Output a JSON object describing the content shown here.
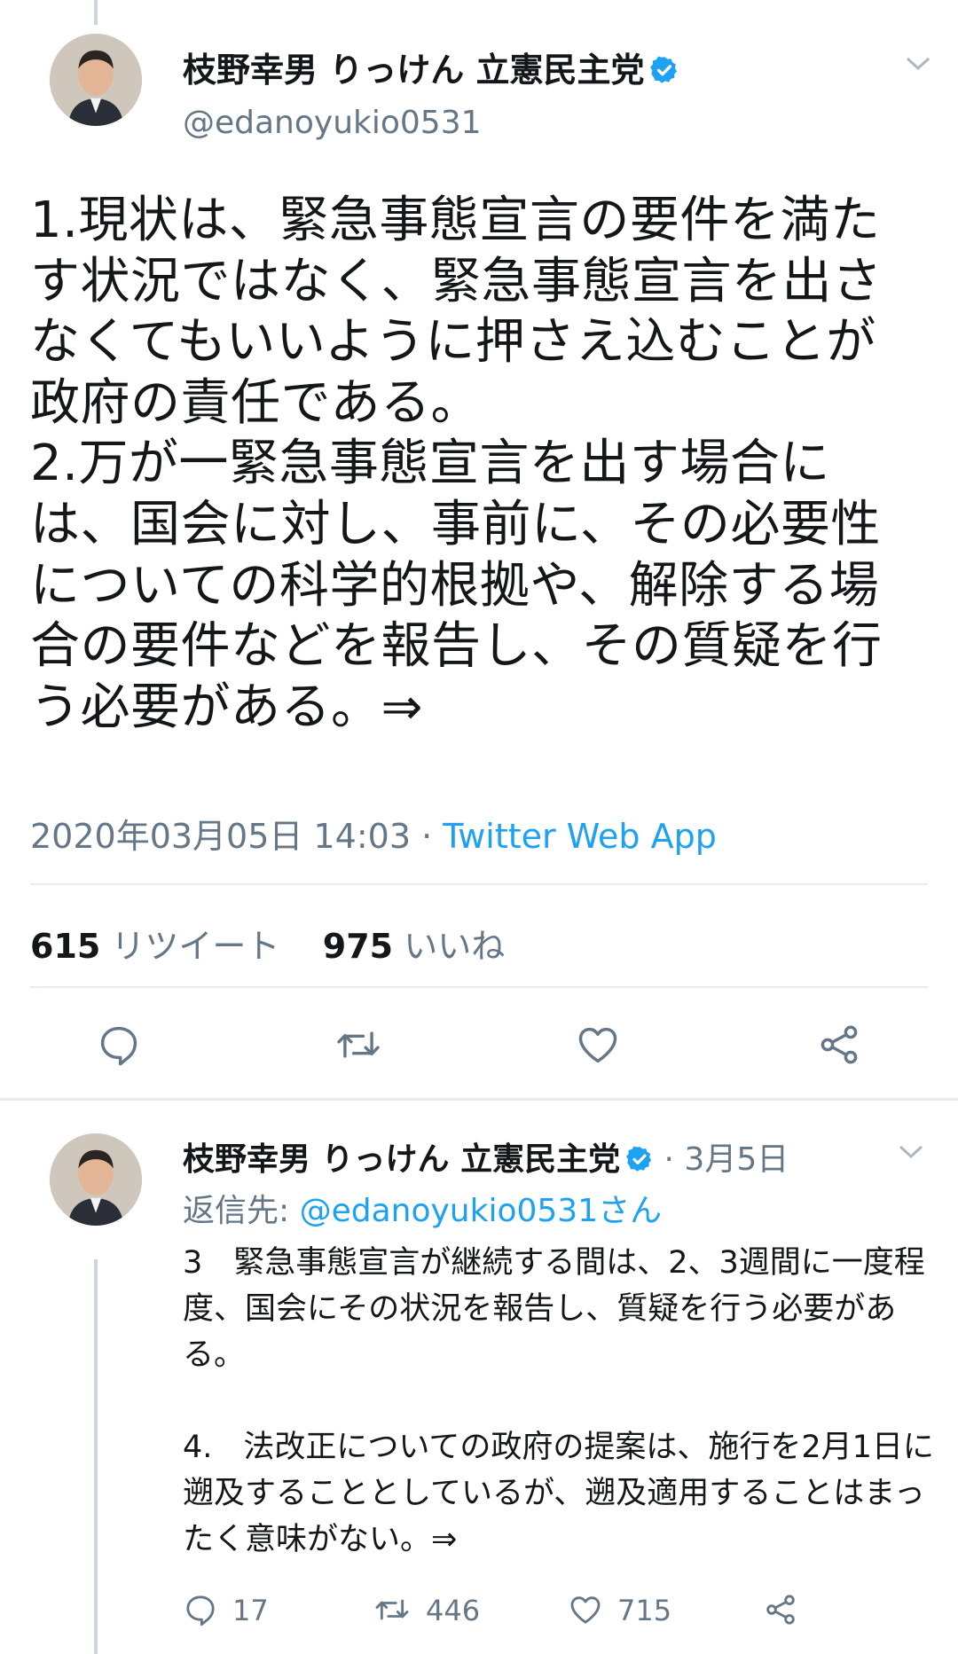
{
  "main_tweet": {
    "author_name": "枝野幸男 りっけん 立憲民主党",
    "handle": "@edanoyukio0531",
    "text": "1.現状は、緊急事態宣言の要件を満たす状況ではなく、緊急事態宣言を出さなくてもいいように押さえ込むことが政府の責任である。\n2.万が一緊急事態宣言を出す場合には、国会に対し、事前に、その必要性についての科学的根拠や、解除する場合の要件などを報告し、その質疑を行う必要がある。⇒",
    "timestamp": "2020年03月05日 14:03",
    "separator": " · ",
    "source": "Twitter Web App",
    "retweet_count": "615",
    "retweet_label": "リツイート",
    "like_count": "975",
    "like_label": "いいね"
  },
  "reply_tweet": {
    "author_name": "枝野幸男 りっけん 立憲民主党",
    "date": "· 3月5日",
    "reply_prefix": "返信先: ",
    "reply_handle": "@edanoyukio0531さん",
    "text": "3　緊急事態宣言が継続する間は、2、3週間に一度程度、国会にその状況を報告し、質疑を行う必要がある。\n\n4.　法改正についての政府の提案は、施行を2月1日に遡及することとしているが、遡及適用することはまったく意味がない。⇒",
    "reply_count": "17",
    "retweet_count": "446",
    "like_count": "715"
  },
  "icons": {
    "reply": "reply-icon",
    "retweet": "retweet-icon",
    "like": "heart-icon",
    "share": "share-icon",
    "verified": "verified-badge-icon",
    "more": "chevron-down-icon"
  },
  "colors": {
    "accent": "#1da1f2",
    "secondary_text": "#657786",
    "text": "#14171a",
    "divider": "#e6ecf0"
  }
}
